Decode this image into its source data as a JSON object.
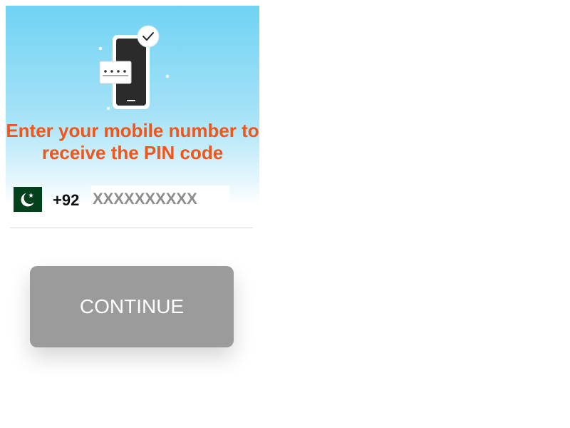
{
  "header": {
    "title_line1": "Enter your mobile number to",
    "title_line2": "receive the PIN code"
  },
  "illustration": {
    "icon": "phone-pin-verification-icon",
    "badge_icon": "checkmark-icon",
    "pin_mask": "• • • •"
  },
  "phone": {
    "country_flag": "pakistan-flag-icon",
    "dial_code": "+92",
    "placeholder": "XXXXXXXXXX",
    "value": ""
  },
  "actions": {
    "continue_label": "CONTINUE"
  },
  "colors": {
    "accent": "#f0561a",
    "panel_top": "#6fd3f3",
    "button_disabled": "#9b9b9b"
  }
}
